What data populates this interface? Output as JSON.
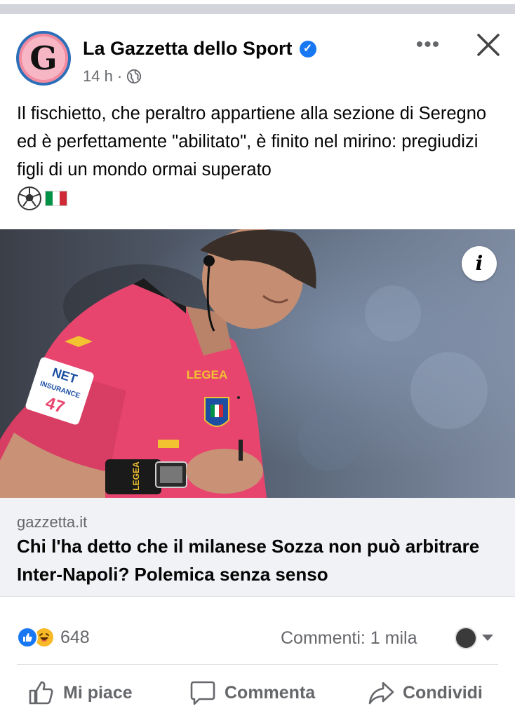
{
  "post": {
    "page_name": "La Gazzetta dello Sport",
    "avatar_letter": "G",
    "time": "14 h",
    "separator": "·",
    "text": "Il fischietto, che peraltro appartiene alla sezione di Seregno ed è perfettamente \"abilitato\", è finito nel mirino: pregiudizi figli di un mondo ormai superato",
    "emojis": [
      "soccer-ball",
      "italy-flag"
    ]
  },
  "link": {
    "domain": "gazzetta.it",
    "headline": "Chi l'ha detto che il milanese Sozza non può arbitrare Inter-Napoli? Polemica senza senso",
    "info_label": "i",
    "image_texts": {
      "sponsor_line1": "NET",
      "sponsor_line2": "INSURANCE",
      "sponsor_number": "47",
      "brand": "LEGEA",
      "sleeve_brand": "LEGEA"
    }
  },
  "engagement": {
    "reaction_count": "648",
    "comments": "Commenti: 1 mila"
  },
  "actions": {
    "like": "Mi piace",
    "comment": "Commenta",
    "share": "Condividi"
  },
  "colors": {
    "accent": "#1877f2",
    "secondary_text": "#65676b",
    "link_bg": "#f0f2f5",
    "referee_shirt": "#e8456e"
  },
  "icons": [
    "verified-badge-icon",
    "globe-icon",
    "more-options-icon",
    "close-icon",
    "info-icon",
    "like-reaction-icon",
    "haha-reaction-icon",
    "dropdown-caret-icon",
    "like-icon",
    "comment-icon",
    "share-icon"
  ]
}
